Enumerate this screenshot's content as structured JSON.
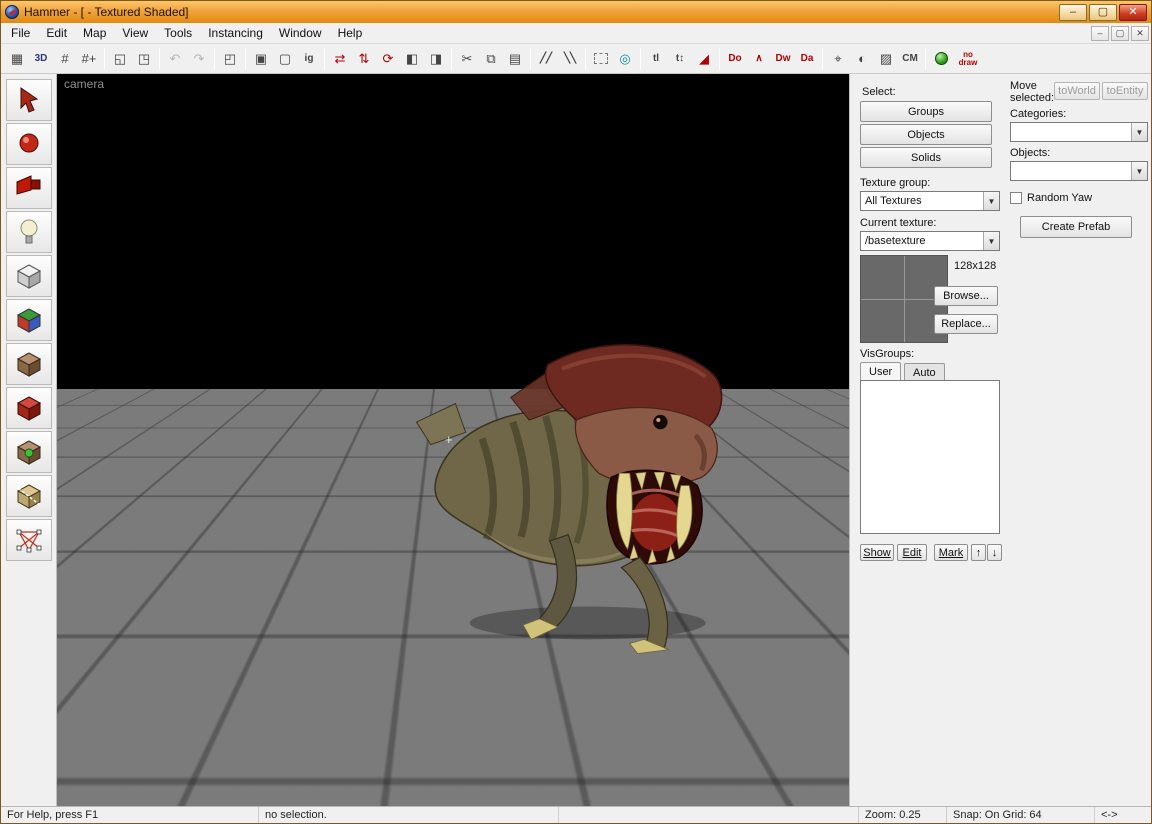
{
  "window": {
    "title": "Hammer - [ - Textured Shaded]",
    "minimize_glyph": "–",
    "maximize_glyph": "▢",
    "close_glyph": "✕"
  },
  "menu": {
    "items": [
      {
        "label": "File"
      },
      {
        "label": "Edit"
      },
      {
        "label": "Map"
      },
      {
        "label": "View"
      },
      {
        "label": "Tools"
      },
      {
        "label": "Instancing"
      },
      {
        "label": "Window"
      },
      {
        "label": "Help"
      }
    ]
  },
  "mdi": {
    "minimize": "–",
    "restore": "▢",
    "close": "✕"
  },
  "toolbar": {
    "items": [
      {
        "name": "toggle-grid",
        "glyph": "▦"
      },
      {
        "name": "toggle-3d-grid",
        "glyph": "3D"
      },
      {
        "name": "smaller-grid",
        "glyph": "#"
      },
      {
        "name": "larger-grid",
        "glyph": "#+"
      },
      {
        "name": "load-window-state",
        "glyph": "◱"
      },
      {
        "name": "save-window-state",
        "glyph": "◳"
      },
      {
        "name": "undo",
        "glyph": "↶"
      },
      {
        "name": "redo",
        "glyph": "↷"
      },
      {
        "name": "carve",
        "glyph": "◰"
      },
      {
        "name": "group",
        "glyph": "▣"
      },
      {
        "name": "ungroup",
        "glyph": "▢"
      },
      {
        "name": "ignore-groups",
        "glyph": "ig"
      },
      {
        "name": "flip-horizontal",
        "glyph": "⇄"
      },
      {
        "name": "flip-vertical",
        "glyph": "⇅"
      },
      {
        "name": "rotate-90",
        "glyph": "⟳"
      },
      {
        "name": "hide-selected",
        "glyph": "◧"
      },
      {
        "name": "show-hidden",
        "glyph": "◨"
      },
      {
        "name": "cut",
        "glyph": "✂"
      },
      {
        "name": "copy",
        "glyph": "⧉"
      },
      {
        "name": "paste",
        "glyph": "▤"
      },
      {
        "name": "texture-lock",
        "glyph": "╱╱"
      },
      {
        "name": "texture-scale-lock",
        "glyph": "╲╲"
      },
      {
        "name": "select-touching",
        "glyph": ""
      },
      {
        "name": "magnify-to-selection",
        "glyph": "◎"
      },
      {
        "name": "texture-lock-small",
        "glyph": "tl"
      },
      {
        "name": "top-bottom-view",
        "glyph": "t↕"
      },
      {
        "name": "wedge-display",
        "glyph": "◢"
      },
      {
        "name": "display-do",
        "glyph": "Do"
      },
      {
        "name": "display-wireframe",
        "glyph": "∧"
      },
      {
        "name": "display-dw",
        "glyph": "Dw"
      },
      {
        "name": "display-da",
        "glyph": "Da"
      },
      {
        "name": "pointfile",
        "glyph": "⌖"
      },
      {
        "name": "sphere-view",
        "glyph": "◐"
      },
      {
        "name": "texture-view-toggle",
        "glyph": "▨"
      },
      {
        "name": "cm-toggle",
        "glyph": "CM"
      },
      {
        "name": "run-map",
        "glyph": ""
      },
      {
        "name": "no-draw",
        "glyph": "no draw"
      }
    ]
  },
  "tool_palette": {
    "items": [
      {
        "name": "selection-tool"
      },
      {
        "name": "magnify-tool"
      },
      {
        "name": "camera-tool"
      },
      {
        "name": "entity-tool"
      },
      {
        "name": "block-tool"
      },
      {
        "name": "texture-application-tool"
      },
      {
        "name": "apply-current-texture-tool"
      },
      {
        "name": "apply-decals-tool"
      },
      {
        "name": "overlay-tool"
      },
      {
        "name": "clipping-tool"
      },
      {
        "name": "vertex-tool"
      }
    ]
  },
  "viewport": {
    "camera_label": "camera",
    "crosshair": "+"
  },
  "panel": {
    "select_label": "Select:",
    "groups_button": "Groups",
    "objects_button": "Objects",
    "solids_button": "Solids",
    "texture_group_label": "Texture group:",
    "texture_group_value": "All Textures",
    "current_texture_label": "Current texture:",
    "current_texture_value": "/basetexture",
    "texture_size": "128x128",
    "browse_button": "Browse...",
    "replace_button": "Replace...",
    "visgroups_label": "VisGroups:",
    "tab_user": "User",
    "tab_auto": "Auto",
    "show_button": "Show",
    "edit_button": "Edit",
    "mark_button": "Mark",
    "up_glyph": "↑",
    "down_glyph": "↓",
    "move_selected_label": "Move selected:",
    "to_world_button": "toWorld",
    "to_entity_button": "toEntity",
    "categories_label": "Categories:",
    "objects_label": "Objects:",
    "random_yaw_label": "Random Yaw",
    "create_prefab_button": "Create Prefab",
    "dropdown_glyph": "▼"
  },
  "statusbar": {
    "help": "For Help, press F1",
    "selection": "no selection.",
    "zoom": "Zoom: 0.25",
    "snap": "Snap: On Grid: 64",
    "coords": "<->"
  },
  "colors": {
    "titlebar_orange": "#f2a33c",
    "panel_gray": "#f0f0f0",
    "accent_red": "#b00000",
    "viewport_black": "#000000",
    "ground_gray": "#7b7b7b"
  }
}
